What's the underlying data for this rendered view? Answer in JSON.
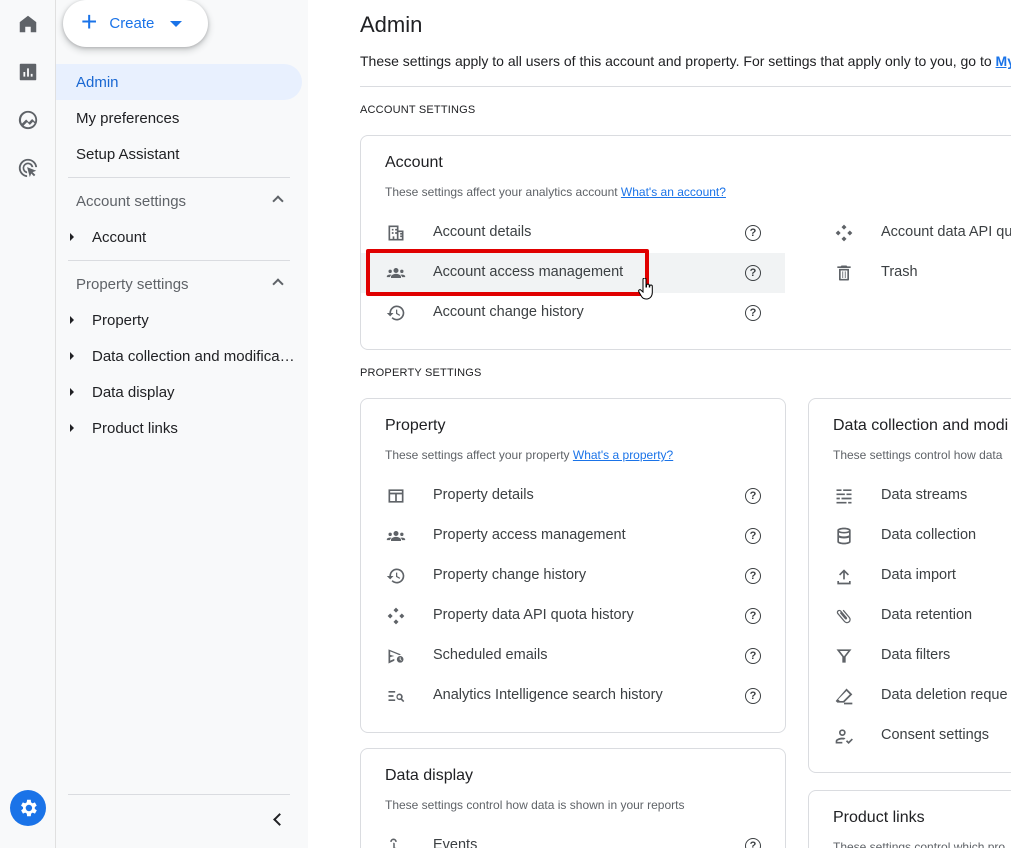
{
  "create": {
    "label": "Create"
  },
  "nav": {
    "admin": "Admin",
    "my_preferences": "My preferences",
    "setup_assistant": "Setup Assistant",
    "account_settings": {
      "header": "Account settings",
      "items": [
        "Account"
      ]
    },
    "property_settings": {
      "header": "Property settings",
      "items": [
        "Property",
        "Data collection and modifica…",
        "Data display",
        "Product links"
      ]
    }
  },
  "page": {
    "title": "Admin",
    "subtitle": "These settings apply to all users of this account and property. For settings that apply only to you, go to ",
    "subtitle_link": "My",
    "account_section": "ACCOUNT SETTINGS",
    "property_section": "PROPERTY SETTINGS"
  },
  "account_card": {
    "title": "Account",
    "subtitle": "These settings affect your analytics account ",
    "link": "What's an account?",
    "left_rows": [
      "Account details",
      "Account access management",
      "Account change history"
    ],
    "right_rows": [
      "Account data API qu",
      "Trash"
    ]
  },
  "property_card": {
    "title": "Property",
    "subtitle": "These settings affect your property ",
    "link": "What's a property?",
    "rows": [
      "Property details",
      "Property access management",
      "Property change history",
      "Property data API quota history",
      "Scheduled emails",
      "Analytics Intelligence search history"
    ]
  },
  "data_collection_card": {
    "title": "Data collection and modi",
    "subtitle": "These settings control how data",
    "rows": [
      "Data streams",
      "Data collection",
      "Data import",
      "Data retention",
      "Data filters",
      "Data deletion reque",
      "Consent settings"
    ]
  },
  "data_display_card": {
    "title": "Data display",
    "subtitle": "These settings control how data is shown in your reports",
    "rows": [
      "Events"
    ]
  },
  "product_links_card": {
    "title": "Product links",
    "subtitle": "These settings control which pro"
  },
  "colors": {
    "accent": "#1a73e8",
    "highlight": "#e00000",
    "active_bg": "#e8f0fe"
  }
}
